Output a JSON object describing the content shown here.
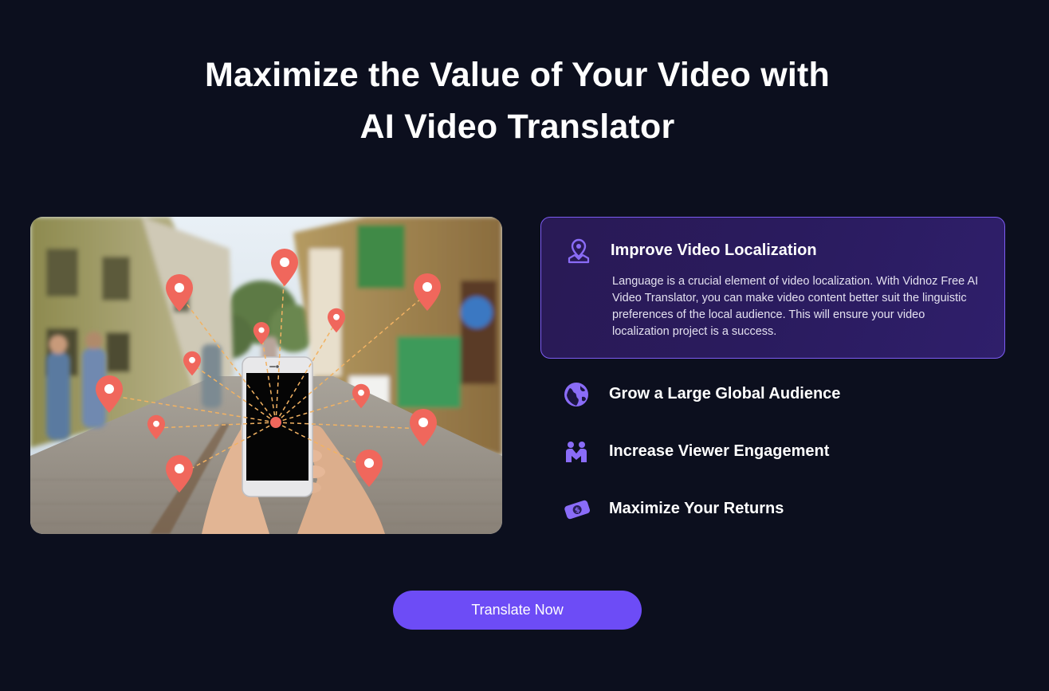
{
  "headline": {
    "line1": "Maximize the Value of Your Video with",
    "line2": "AI Video Translator"
  },
  "hero_image": {
    "description_icon": "street-scene-phone-photo"
  },
  "features": [
    {
      "title": "Improve Video Localization",
      "description": "Language is a crucial element of video localization. With Vidnoz Free AI Video Translator, you can make video content better suit the linguistic preferences of the local audience. This will ensure your video localization project is a success.",
      "icon": "location-map-icon",
      "expanded": true
    },
    {
      "title": "Grow a Large Global Audience",
      "icon": "globe-icon"
    },
    {
      "title": "Increase Viewer Engagement",
      "icon": "people-icon"
    },
    {
      "title": "Maximize Your Returns",
      "icon": "money-icon"
    }
  ],
  "cta": {
    "label": "Translate Now"
  },
  "colors": {
    "background": "#0c0f1e",
    "accent": "#6d4cf6",
    "card_border": "#7c5cf2",
    "pin": "#f0675c",
    "icon": "#8a6cf7"
  }
}
